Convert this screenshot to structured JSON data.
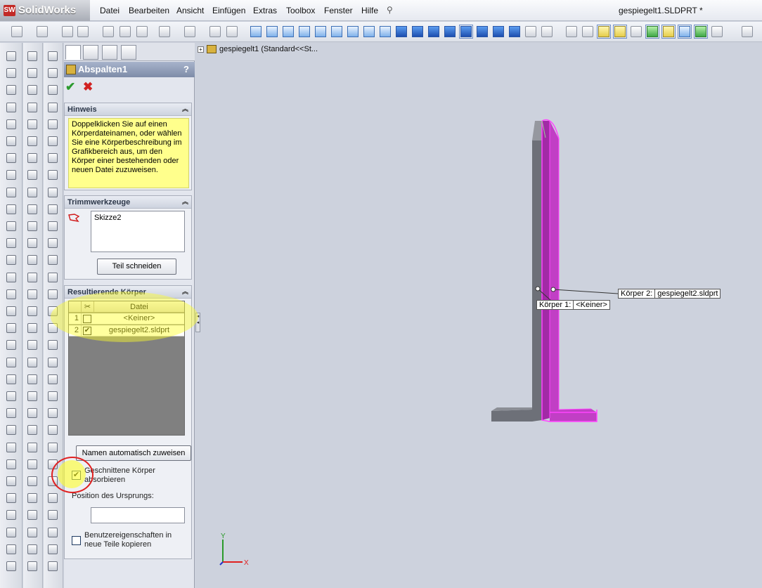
{
  "app": {
    "name": "SolidWorks",
    "logo_mark": "SW",
    "document_title": "gespiegelt1.SLDPRT *"
  },
  "menu": [
    "Datei",
    "Bearbeiten",
    "Ansicht",
    "Einfügen",
    "Extras",
    "Toolbox",
    "Fenster",
    "Hilfe"
  ],
  "feature": {
    "title": "Abspalten1",
    "help": "?"
  },
  "hint": {
    "title": "Hinweis",
    "text": "Doppelklicken Sie auf einen Körperdateinamen, oder wählen Sie eine Körperbeschreibung im Grafikbereich aus, um den Körper einer bestehenden oder neuen Datei zuzuweisen."
  },
  "trim": {
    "title": "Trimmwerkzeuge",
    "list": [
      "Skizze2"
    ],
    "button": "Teil schneiden"
  },
  "bodies": {
    "title": "Resultierende Körper",
    "col_file": "Datei",
    "rows": [
      {
        "num": "1",
        "file": "<Keiner>",
        "checked": false
      },
      {
        "num": "2",
        "file": "gespiegelt2.sldprt",
        "checked": true
      }
    ]
  },
  "auto_name_button": "Namen automatisch zuweisen",
  "absorb": {
    "label": "Geschnittene Körper absorbieren",
    "checked": true
  },
  "origin": {
    "label": "Position des Ursprungs:",
    "value": ""
  },
  "copy_props": {
    "label": "Benutzereigenschaften in neue Teile kopieren",
    "checked": false
  },
  "tree": {
    "item": "gespiegelt1  (Standard<<St..."
  },
  "callouts": {
    "body1_label": "Körper  1:",
    "body1_value": "<Keiner>",
    "body2_label": "Körper  2:",
    "body2_value": "gespiegelt2.sldprt"
  },
  "triad": {
    "x": "X",
    "y": "Y"
  },
  "colors": {
    "selection": "#cc00cc",
    "highlight": "#ffff33",
    "annotation": "#e02020"
  }
}
